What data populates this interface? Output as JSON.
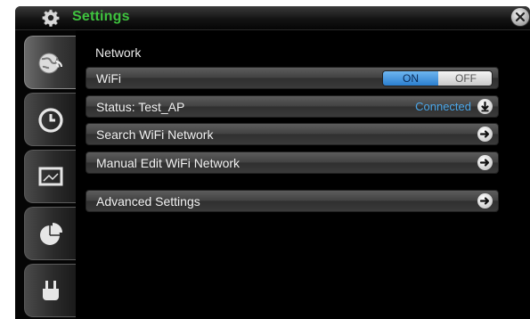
{
  "titlebar": {
    "title": "Settings",
    "icon": "gear-icon",
    "close_icon": "close-icon"
  },
  "sidebar": {
    "tabs": [
      {
        "icon": "network-globe-icon",
        "active": true
      },
      {
        "icon": "clock-icon",
        "active": false
      },
      {
        "icon": "display-icon",
        "active": false
      },
      {
        "icon": "pie-chart-icon",
        "active": false
      },
      {
        "icon": "power-plug-icon",
        "active": false
      }
    ]
  },
  "content": {
    "section_title": "Network",
    "wifi": {
      "label": "WiFi",
      "on_label": "ON",
      "off_label": "OFF",
      "state": "ON"
    },
    "status": {
      "label": "Status: Test_AP",
      "value": "Connected"
    },
    "search": {
      "label": "Search WiFi Network"
    },
    "manual": {
      "label": "Manual Edit WiFi Network"
    },
    "advanced": {
      "label": "Advanced Settings"
    }
  },
  "colors": {
    "title_green": "#3ec23e",
    "accent_blue": "#4aa6e8",
    "toggle_on": "#2b7fd0"
  }
}
